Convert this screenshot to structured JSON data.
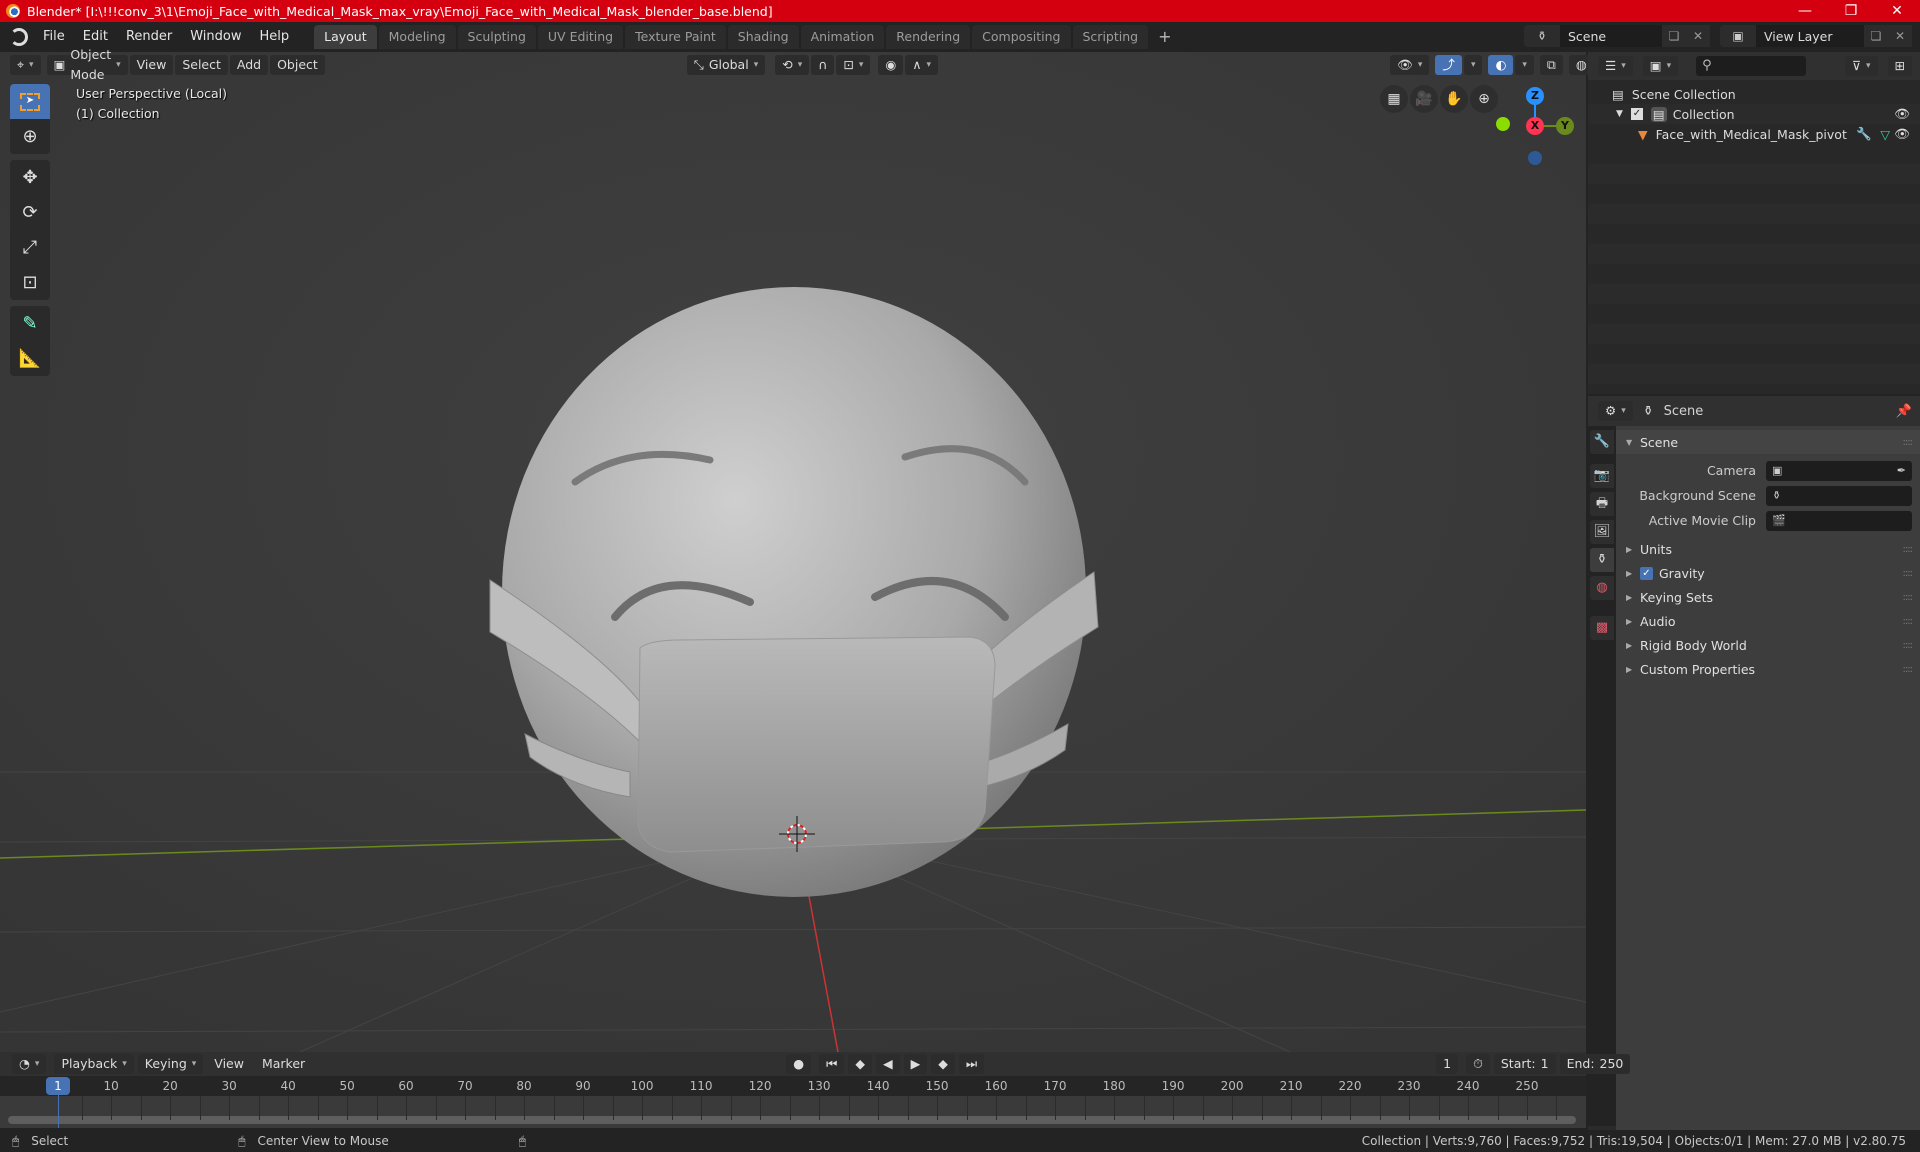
{
  "window": {
    "title": "Blender* [I:\\!!!conv_3\\1\\Emoji_Face_with_Medical_Mask_max_vray\\Emoji_Face_with_Medical_Mask_blender_base.blend]",
    "controls": {
      "minimize": "—",
      "maximize": "❐",
      "close": "✕"
    }
  },
  "menubar": {
    "items": [
      "File",
      "Edit",
      "Render",
      "Window",
      "Help"
    ],
    "workspaces": [
      "Layout",
      "Modeling",
      "Sculpting",
      "UV Editing",
      "Texture Paint",
      "Shading",
      "Animation",
      "Rendering",
      "Compositing",
      "Scripting"
    ],
    "active_workspace": "Layout",
    "add_workspace": "+",
    "scene": "Scene",
    "view_layer": "View Layer"
  },
  "viewport": {
    "mode": "Object Mode",
    "menus": [
      "View",
      "Select",
      "Add",
      "Object"
    ],
    "orientation": "Global",
    "info_line1": "User Perspective (Local)",
    "info_line2": "(1) Collection",
    "gizmo_axes": {
      "z": "Z",
      "x": "X",
      "y": "Y"
    },
    "axis_colors": {
      "x": "#ff3352",
      "y": "#8bdc00",
      "z": "#2890ff"
    },
    "tools": [
      "select-box",
      "cursor",
      "move",
      "rotate",
      "scale",
      "transform",
      "annotate",
      "measure"
    ],
    "nav_buttons": [
      "toggle-grid",
      "camera-view",
      "pan",
      "zoom"
    ]
  },
  "outliner": {
    "root": "Scene Collection",
    "collection": "Collection",
    "object": "Face_with_Medical_Mask_pivot"
  },
  "properties": {
    "context": "Scene",
    "panel_title": "Scene",
    "fields": [
      {
        "label": "Camera",
        "value": ""
      },
      {
        "label": "Background Scene",
        "value": ""
      },
      {
        "label": "Active Movie Clip",
        "value": ""
      }
    ],
    "panels": [
      "Units",
      "Gravity",
      "Keying Sets",
      "Audio",
      "Rigid Body World",
      "Custom Properties"
    ],
    "gravity_checked": true
  },
  "timeline": {
    "menus": [
      "Playback",
      "Keying",
      "View",
      "Marker"
    ],
    "current_frame": "1",
    "start_label": "Start:",
    "start": "1",
    "end_label": "End:",
    "end": "250",
    "ticks": [
      "10",
      "20",
      "30",
      "40",
      "50",
      "60",
      "70",
      "80",
      "90",
      "100",
      "110",
      "120",
      "130",
      "140",
      "150",
      "160",
      "170",
      "180",
      "190",
      "200",
      "210",
      "220",
      "230",
      "240",
      "250"
    ],
    "playhead_label": "1"
  },
  "statusbar": {
    "left_action": "Select",
    "middle_action": "Center View to Mouse",
    "stats": "Collection | Verts:9,760 | Faces:9,752 | Tris:19,504 | Objects:0/1 | Mem: 27.0 MB | v2.80.75"
  }
}
